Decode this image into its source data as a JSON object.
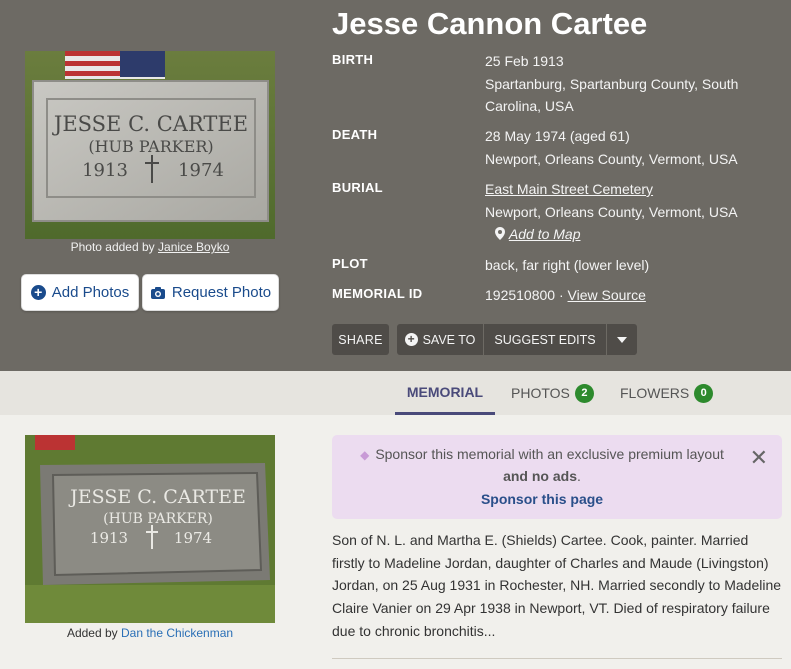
{
  "memorial": {
    "name": "Jesse Cannon Cartee",
    "birth_label": "BIRTH",
    "birth_date": "25 Feb 1913",
    "birth_place": "Spartanburg, Spartanburg County, South Carolina, USA",
    "death_label": "DEATH",
    "death_date": "28 May 1974 (aged 61)",
    "death_place": "Newport, Orleans County, Vermont, USA",
    "burial_label": "BURIAL",
    "burial_cemetery": "East Main Street Cemetery",
    "burial_place": "Newport, Orleans County, Vermont, USA",
    "add_to_map": "Add to Map",
    "plot_label": "PLOT",
    "plot_value": "back, far right (lower level)",
    "memorial_id_label": "MEMORIAL ID",
    "memorial_id": "192510800 ·",
    "view_source": "View Source"
  },
  "header_photo": {
    "caption_prefix": "Photo added by",
    "caption_author": "Janice Boyko",
    "stone_line1": "JESSE C. CARTEE",
    "stone_line2": "(HUB PARKER)",
    "stone_year1": "1913",
    "stone_year2": "1974"
  },
  "buttons": {
    "add_photos": "Add Photos",
    "request_photo": "Request Photo",
    "share": "SHARE",
    "save_to": "SAVE TO",
    "suggest_edits": "SUGGEST EDITS"
  },
  "tabs": {
    "memorial": "MEMORIAL",
    "photos": "PHOTOS",
    "photos_count": "2",
    "flowers": "FLOWERS",
    "flowers_count": "0"
  },
  "main_photo": {
    "caption_prefix": "Added by",
    "caption_author": "Dan the Chickenman",
    "stone_line1": "JESSE C. CARTEE",
    "stone_line2": "(HUB PARKER)",
    "stone_year1": "1913",
    "stone_year2": "1974"
  },
  "sponsor": {
    "line1": "Sponsor this memorial with an exclusive premium layout",
    "line2_bold": "and no ads",
    "line2_end": ".",
    "cta": "Sponsor this page"
  },
  "bio": "Son of N. L. and Martha E. (Shields) Cartee. Cook, painter. Married firstly to Madeline Jordan, daughter of Charles and Maude (Livingston) Jordan, on 25 Aug 1931 in Rochester, NH. Married secondly to Madeline Claire Vanier on 29 Apr 1938 in Newport, VT. Died of respiratory failure due to chronic bronchitis...",
  "colors": {
    "hero_bg": "#6d6a64",
    "accent_blue": "#1a4b8c",
    "tab_active": "#4a4a7a",
    "badge_green": "#2d8a2d",
    "sponsor_bg": "#ecdcf0"
  }
}
